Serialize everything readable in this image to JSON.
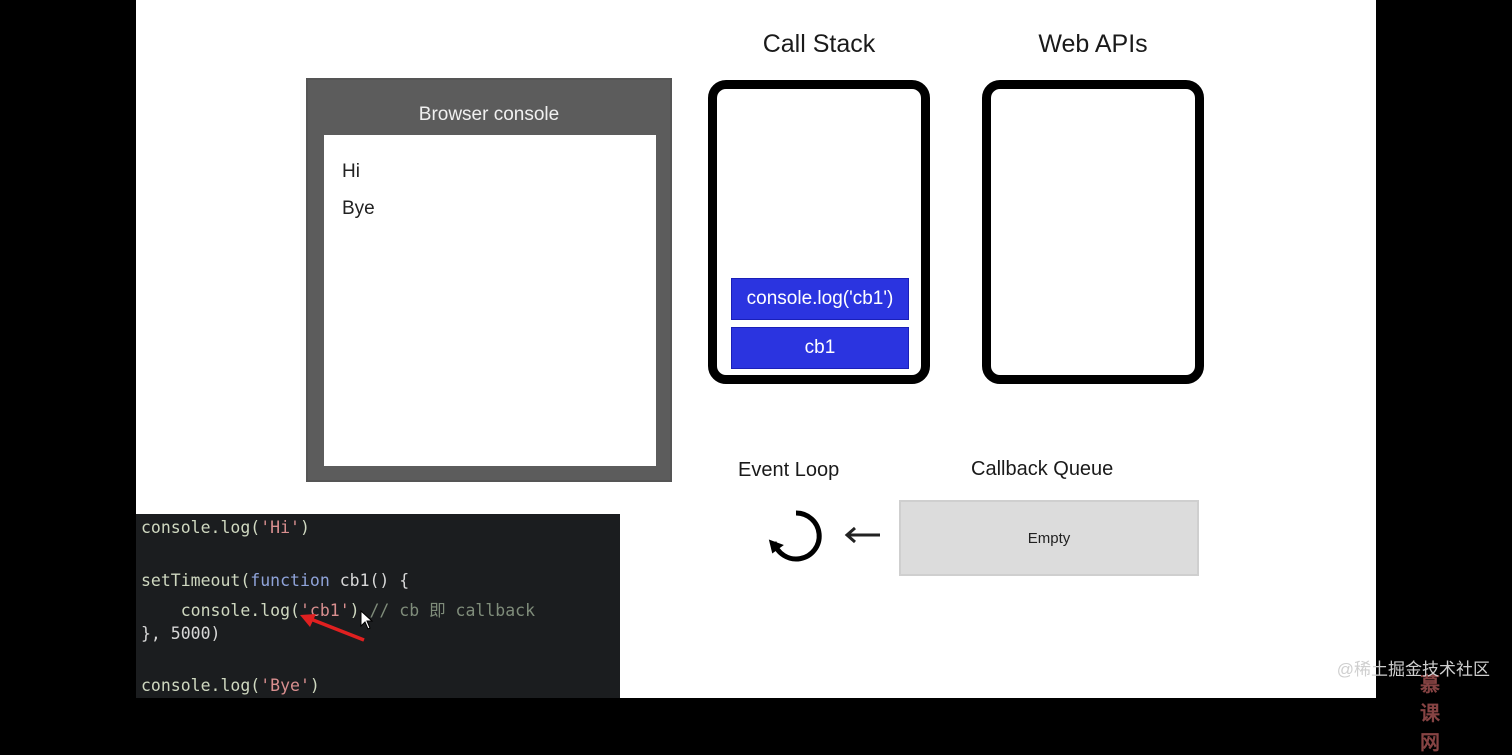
{
  "browser_console": {
    "title": "Browser console",
    "lines": [
      "Hi",
      "Bye"
    ]
  },
  "call_stack": {
    "title": "Call Stack",
    "items": [
      "console.log('cb1')",
      "cb1"
    ]
  },
  "web_apis": {
    "title": "Web APIs"
  },
  "event_loop": {
    "label": "Event Loop",
    "arrow": "←"
  },
  "callback_queue": {
    "label": "Callback Queue",
    "content": "Empty"
  },
  "code": {
    "line1": [
      "console.log(",
      "'Hi'",
      ")"
    ],
    "line3": [
      "setTimeout(",
      "function",
      " cb1() {"
    ],
    "line4": [
      "    console.log(",
      "'cb1'",
      ") ",
      "// cb 即 callback"
    ],
    "line5": [
      "}, 5000)"
    ],
    "line7": [
      "console.log(",
      "'Bye'",
      ")"
    ]
  },
  "watermark": "@稀土掘金技术社区",
  "logo": "慕课网",
  "colors": {
    "stack_item": "#2b34e0",
    "browser_frame": "#5c5c5c",
    "queue_bg": "#dcdcdc",
    "code_bg": "#1b1d1f",
    "annotation_arrow": "#e02020"
  }
}
